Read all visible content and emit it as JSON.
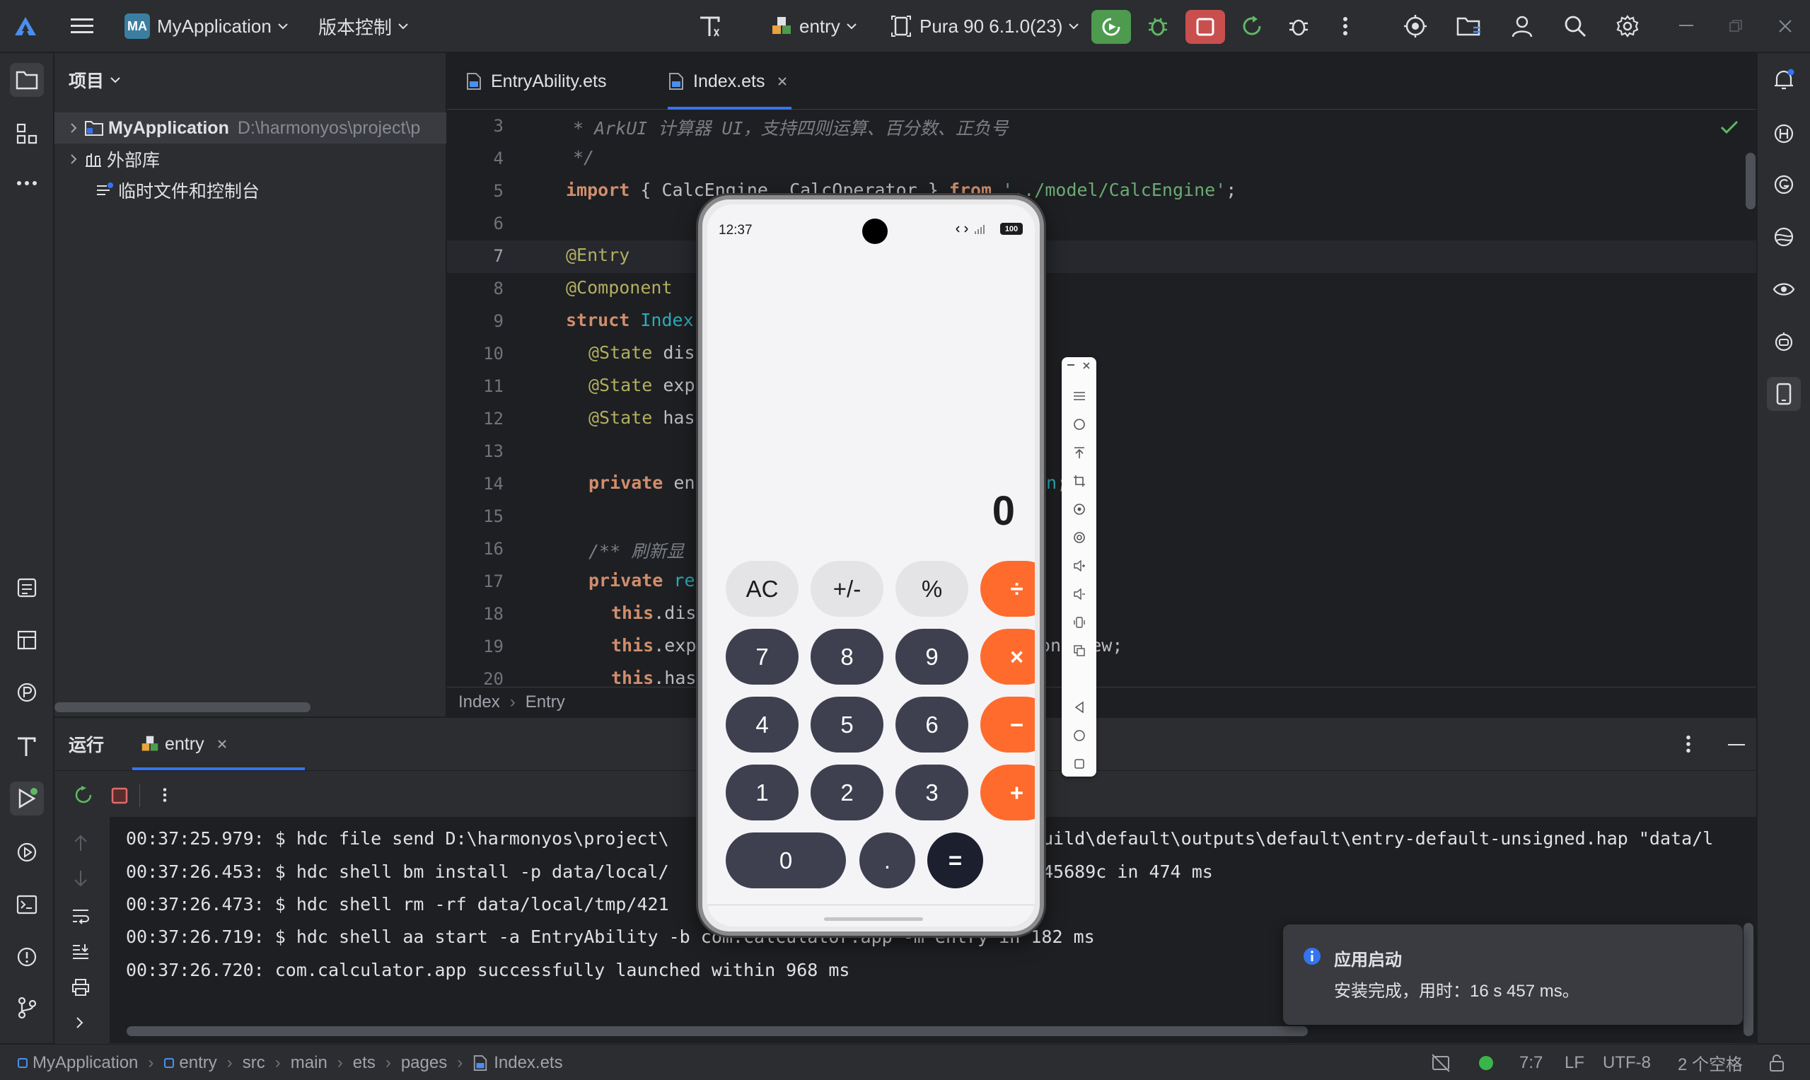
{
  "titlebar": {
    "project_badge": "MA",
    "project_name": "MyApplication",
    "vcs_label": "版本控制",
    "run_config": "entry",
    "device": "Pura 90 6.1.0(23)"
  },
  "project_panel": {
    "title": "项目",
    "tree": [
      {
        "label": "MyApplication",
        "path": "D:\\harmonyos\\project\\p"
      },
      {
        "label": "外部库"
      },
      {
        "label": "临时文件和控制台"
      }
    ]
  },
  "editor": {
    "tabs": [
      {
        "label": "EntryAbility.ets"
      },
      {
        "label": "Index.ets"
      }
    ],
    "line_numbers": [
      "3",
      "4",
      "5",
      "6",
      "7",
      "8",
      "9",
      "10",
      "11",
      "12",
      "13",
      "14",
      "15",
      "16",
      "17",
      "18",
      "19",
      "20"
    ],
    "lines": {
      "l3": "* ArkUI 计算器 UI，支持四则运算、百分数、正负号",
      "l4": "*/",
      "l5_kw": "import",
      "l5_a": " { CalcEngine, CalcOperator } ",
      "l5_from": "from",
      "l5_str": "'../model/CalcEngine'",
      "l5_end": ";",
      "l7": "@Entry",
      "l8": "@Component",
      "l9_kw": "struct",
      "l9_name": "Index",
      "l10_ann": "@State",
      "l10_rest": " dis",
      "l11_ann": "@State",
      "l11_rest": " exp",
      "l12_ann": "@State",
      "l12_rest": " has",
      "l14_kw": "private",
      "l14_rest": " en",
      "l14_tail": "in",
      "l14_semi": ";",
      "l16": "/** 刷新显",
      "l17_kw": "private",
      "l17_rest": " re",
      "l18_kw": "this",
      "l18_rest": ".dis",
      "l19_kw": "this",
      "l19_rest": ".exp",
      "l19_tail": "on",
      "l19_tail2": "view;",
      "l20_kw": "this",
      "l20_rest": ".has"
    },
    "breadcrumb": [
      "Index",
      "Entry"
    ]
  },
  "run_panel": {
    "tab_run": "运行",
    "tab_entry": "entry",
    "console_lines": [
      {
        "a": "00:37:25.979: $ hdc file send D:\\harmonyos\\project\\",
        "b": "uild\\default\\outputs\\default\\entry-default-unsigned.hap \"data/l"
      },
      {
        "a": "00:37:26.453: $ hdc shell bm install -p data/local/",
        "b": "45689c in 474 ms"
      },
      {
        "a": "00:37:26.473: $ hdc shell rm -rf data/local/tmp/421",
        "b": ""
      },
      {
        "a": "00:37:26.719: $ hdc shell aa start -a EntryAbility -b com.calculator.app -m entry in 182 ms",
        "b": ""
      },
      {
        "a": "00:37:26.720: com.calculator.app successfully launched within 968 ms",
        "b": ""
      }
    ]
  },
  "notification": {
    "title": "应用启动",
    "body": "安装完成，用时：16 s 457 ms。"
  },
  "statusbar": {
    "path": [
      "MyApplication",
      "entry",
      "src",
      "main",
      "ets",
      "pages",
      "Index.ets"
    ],
    "position": "7:7",
    "line_sep": "LF",
    "encoding": "UTF-8",
    "indent": "2 个空格"
  },
  "phone": {
    "time": "12:37",
    "battery": "100",
    "display": "0",
    "buttons": {
      "ac": "AC",
      "sign": "+/-",
      "pct": "%",
      "div": "÷",
      "n7": "7",
      "n8": "8",
      "n9": "9",
      "mul": "×",
      "n4": "4",
      "n5": "5",
      "n6": "6",
      "sub": "−",
      "n1": "1",
      "n2": "2",
      "n3": "3",
      "add": "+",
      "n0": "0",
      "dot": ".",
      "eq": "="
    }
  },
  "colors": {
    "accent": "#3574f0",
    "run_green": "#4e9a4f",
    "stop_red": "#c94f4f",
    "calc_orange": "#ff6b2c",
    "calc_dark": "#3e4050"
  }
}
